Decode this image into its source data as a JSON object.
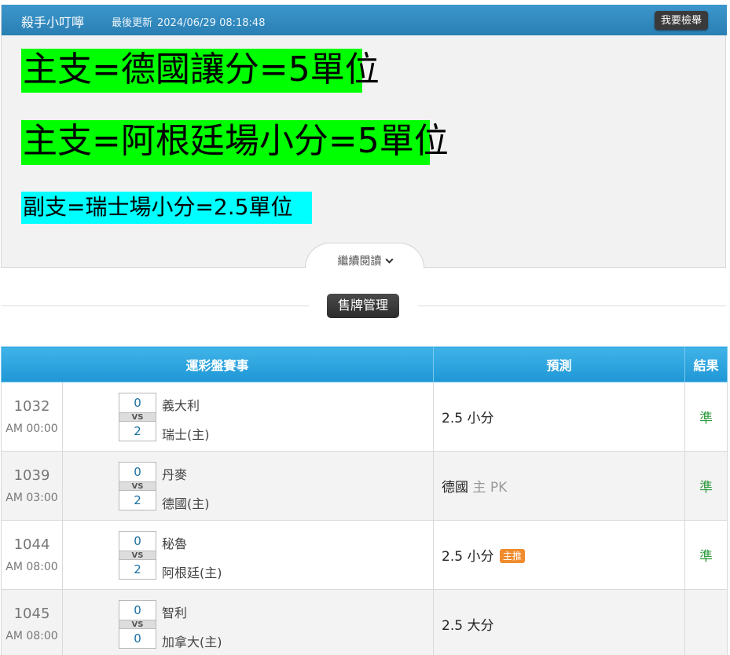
{
  "article": {
    "author": "殺手小叮嚀",
    "updated_label": "最後更新",
    "updated_time": "2024/06/29 08:18:48",
    "report_label": "我要檢舉",
    "headlines": [
      "主支=德國讓分=5單位",
      "主支=阿根廷場小分=5單位",
      "副支=瑞士場小分=2.5單位"
    ],
    "headline_colors": [
      "#00ff00",
      "#00ff00",
      "#00ffff"
    ],
    "read_more_label": "繼續閱讀"
  },
  "manage_label": "售牌管理",
  "table": {
    "headers": {
      "match": "運彩盤賽事",
      "prediction": "預測",
      "result": "結果"
    },
    "rows": [
      {
        "id": "1032",
        "time": "AM 00:00",
        "away_score": "0",
        "home_score": "2",
        "vs": "VS",
        "away_team": "義大利",
        "home_team": "瑞士(主)",
        "prediction": "2.5 小分",
        "prediction_extra": "",
        "badge": "",
        "result": "準"
      },
      {
        "id": "1039",
        "time": "AM 03:00",
        "away_score": "0",
        "home_score": "2",
        "vs": "VS",
        "away_team": "丹麥",
        "home_team": "德國(主)",
        "prediction": "德國",
        "prediction_extra": "主 PK",
        "badge": "",
        "result": "準"
      },
      {
        "id": "1044",
        "time": "AM 08:00",
        "away_score": "0",
        "home_score": "2",
        "vs": "VS",
        "away_team": "秘魯",
        "home_team": "阿根廷(主)",
        "prediction": "2.5 小分",
        "prediction_extra": "",
        "badge": "主推",
        "result": "準"
      },
      {
        "id": "1045",
        "time": "AM 08:00",
        "away_score": "0",
        "home_score": "0",
        "vs": "VS",
        "away_team": "智利",
        "home_team": "加拿大(主)",
        "prediction": "2.5 大分",
        "prediction_extra": "",
        "badge": "",
        "result": ""
      }
    ]
  },
  "colors": {
    "header_blue": "#2a7fb3",
    "table_header_blue": "#1f97d6",
    "result_green": "#2e9a3c",
    "badge_orange": "#f08c2e"
  }
}
